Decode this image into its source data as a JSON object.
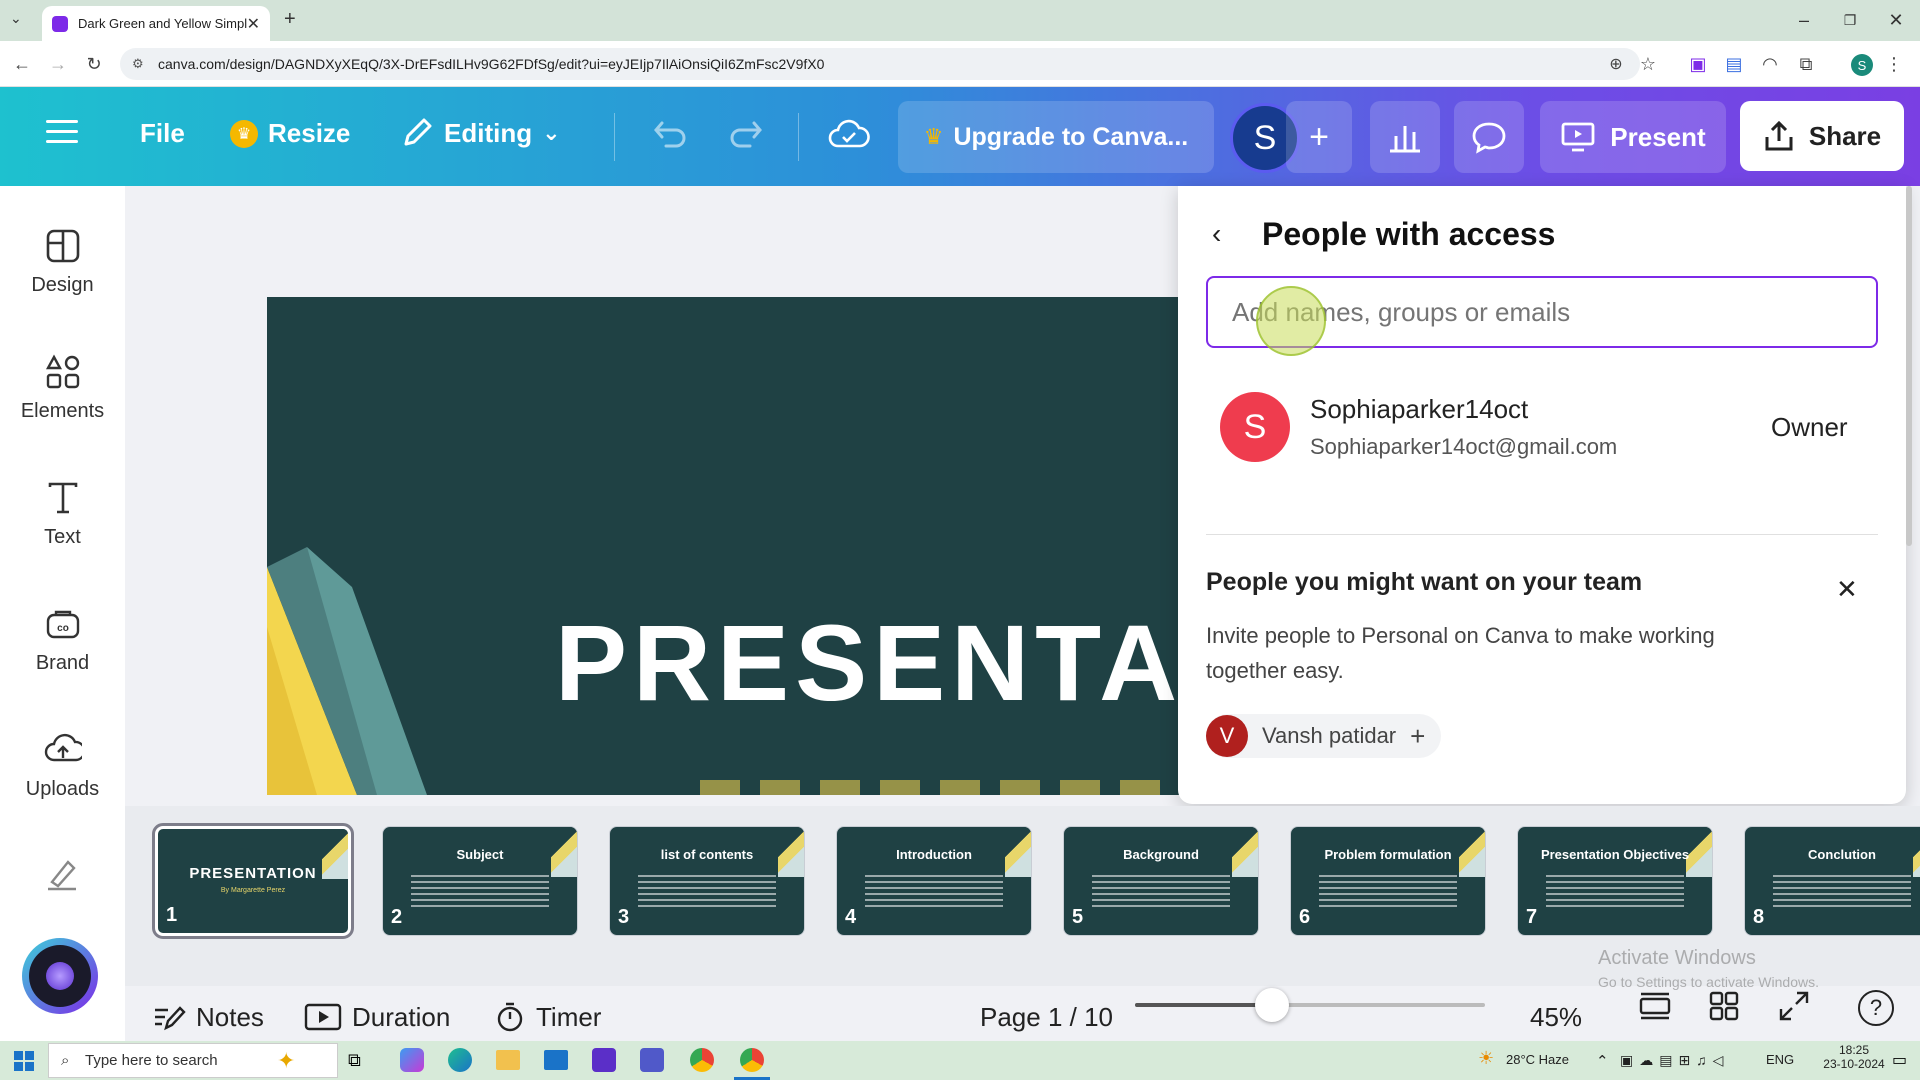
{
  "browser": {
    "tab_title": "Dark Green and Yellow Simple I",
    "url": "canva.com/design/DAGNDXyXEqQ/3X-DrEFsdILHv9G62FDfSg/edit?ui=eyJEIjp7IlAiOnsiQiI6ZmFsc2V9fX0"
  },
  "header": {
    "file_label": "File",
    "resize_label": "Resize",
    "editing_label": "Editing",
    "upgrade_label": "Upgrade to Canva...",
    "avatar_letter": "S",
    "present_label": "Present",
    "share_label": "Share"
  },
  "sidebar": {
    "items": [
      {
        "label": "Design",
        "icon": "design-icon"
      },
      {
        "label": "Elements",
        "icon": "elements-icon"
      },
      {
        "label": "Text",
        "icon": "text-icon"
      },
      {
        "label": "Brand",
        "icon": "brand-icon"
      },
      {
        "label": "Uploads",
        "icon": "uploads-icon"
      }
    ]
  },
  "slide": {
    "title": "PRESENTA"
  },
  "share_panel": {
    "title": "People with access",
    "input_placeholder": "Add names, groups or emails",
    "owner": {
      "avatar_letter": "S",
      "name": "Sophiaparker14oct",
      "email": "Sophiaparker14oct@gmail.com",
      "role": "Owner"
    },
    "team_title": "People you might want on your team",
    "team_desc": "Invite people to Personal on Canva to make working together easy.",
    "suggestion": {
      "avatar_letter": "V",
      "name": "Vansh patidar"
    }
  },
  "thumbnails": [
    {
      "num": "1",
      "title": "PRESENTATION",
      "subtitle": "By Margarette Perez"
    },
    {
      "num": "2",
      "title": "Subject"
    },
    {
      "num": "3",
      "title": "list of contents"
    },
    {
      "num": "4",
      "title": "Introduction"
    },
    {
      "num": "5",
      "title": "Background"
    },
    {
      "num": "6",
      "title": "Problem formulation"
    },
    {
      "num": "7",
      "title": "Presentation Objectives"
    },
    {
      "num": "8",
      "title": "Conclution"
    }
  ],
  "bottom": {
    "notes_label": "Notes",
    "duration_label": "Duration",
    "timer_label": "Timer",
    "page_label": "Page 1 / 10",
    "zoom_label": "45%",
    "zoom_fraction": 0.39
  },
  "watermark": {
    "line1": "Activate Windows",
    "line2": "Go to Settings to activate Windows."
  },
  "taskbar": {
    "search_placeholder": "Type here to search",
    "weather": "28°C  Haze",
    "lang": "ENG",
    "time": "18:25",
    "date": "23-10-2024"
  },
  "colors": {
    "accent": "#7d2ae8",
    "slide_bg": "#1f4144",
    "owner_avatar": "#ef3c4e"
  }
}
